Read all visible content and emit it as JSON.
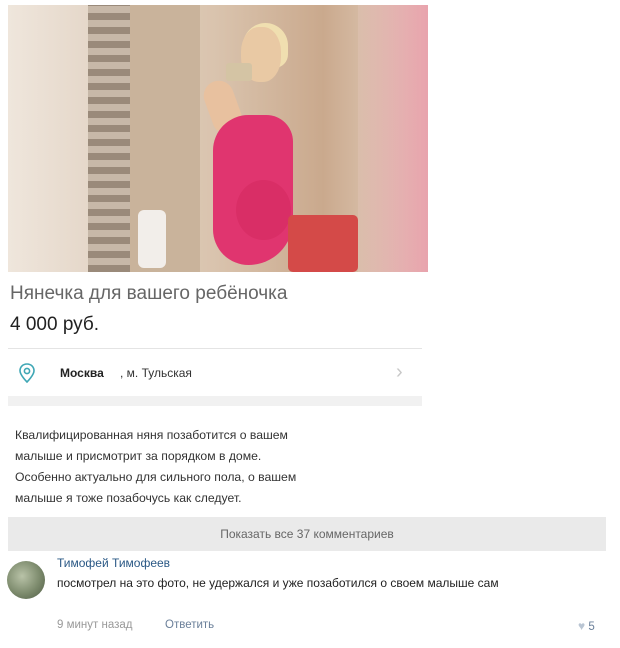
{
  "listing": {
    "title": "Нянечка для вашего ребёночка",
    "price": "4 000 руб.",
    "location": {
      "city": "Москва",
      "metro": ", м. Тульская"
    },
    "description": "Квалифицированная няня позаботится о вашем\nмалыше и присмотрит за порядком в доме.\nОсобенно актуально для сильного пола, о вашем\nмалыше я тоже позабочусь как следует."
  },
  "comments": {
    "show_all_label": "Показать все 37 комментариев",
    "items": [
      {
        "author": "Тимофей Тимофеев",
        "text": "посмотрел на это фото, не удержался и уже позаботился о своем малыше сам",
        "time": "9 минут назад",
        "reply_label": "Ответить",
        "likes": "5"
      }
    ]
  },
  "colors": {
    "accent": "#2a5885",
    "pin": "#3fa7b5",
    "dress": "#e0356f"
  }
}
